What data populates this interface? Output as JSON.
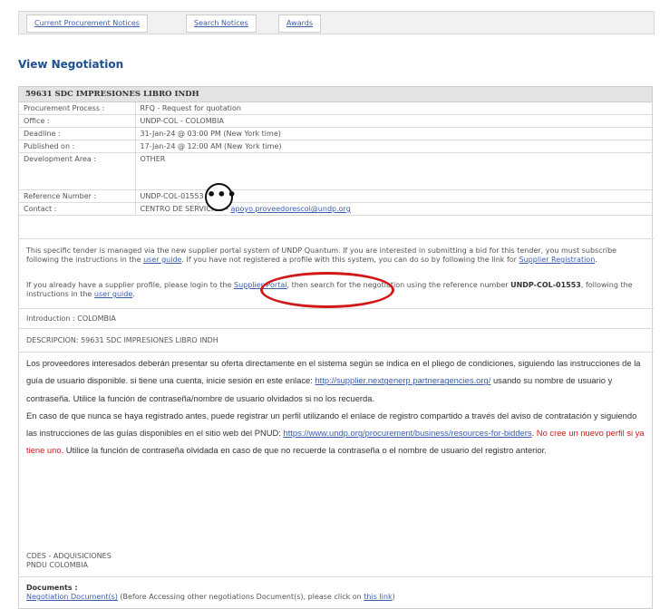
{
  "tabs": [
    {
      "label": "Current Procurement Notices"
    },
    {
      "label": "Search Notices"
    },
    {
      "label": "Awards"
    }
  ],
  "page_title": "View Negotiation",
  "negotiation": {
    "header": "59631 SDC IMPRESIONES LIBRO INDH",
    "rows": [
      {
        "label": "Procurement Process :",
        "value": "RFQ - Request for quotation"
      },
      {
        "label": "Office :",
        "value": "UNDP-COL - COLOMBIA"
      },
      {
        "label": "Deadline :",
        "value": "31-Jan-24 @ 03:00 PM (New York time)"
      },
      {
        "label": "Published on :",
        "value": "17-Jan-24 @ 12:00 AM (New York time)"
      },
      {
        "label": "Development Area :",
        "value": "OTHER"
      },
      {
        "label": "Reference Number :",
        "value": "UNDP-COL-01553"
      },
      {
        "label": "Contact :",
        "value": "CENTRO DE SERVICIOS - ",
        "link": "apoyo.proveedorescol@undp.org"
      }
    ]
  },
  "overflow_icon": "•••",
  "notice1": {
    "t1": "This specific tender is managed via the new supplier portal system of UNDP Quantum. If you are interested in submitting a bid for this tender, you must subscribe following the instructions in the ",
    "link1": "user guide",
    "t2": ". If you have not registered a profile with this system, you can do so by following the link for ",
    "link2": "Supplier Registration",
    "t3": "."
  },
  "notice2": {
    "t1": "If you already have a supplier profile, please login to the ",
    "link1": "Supplier Portal",
    "t2": ", then search for the negotiation using the reference number ",
    "ref": "UNDP-COL-01553",
    "t3": ", following the instructions in the ",
    "link2": "user guide",
    "t4": "."
  },
  "introduction": "Introduction : COLOMBIA",
  "descripcion": "DESCRIPCION: 59631 SDC IMPRESIONES LIBRO INDH",
  "desc": {
    "p1_a": "Los proveedores interesados deberán presentar su oferta directamente en el sistema según se indica en el pliego de condiciones, siguiendo las instrucciones de la guía de usuario disponible. si tiene una cuenta, inicie sesión en este enlace: ",
    "p1_link": "http://supplier.nextgenerp.partneragencies.org/",
    "p1_b": " usando su nombre de usuario y contraseña. Utilice la función de contraseña/nombre de usuario olvidados si no los recuerda.",
    "p2_a": "En caso de que nunca se haya registrado antes, puede registrar un perfil utilizando el enlace de registro compartido a través del aviso de contratación y siguiendo las instrucciones de las guías disponibles en el sitio web del PNUD: ",
    "p2_link": "https://www.undp.org/procurement/business/resources-for-bidders",
    "p2_b": ". ",
    "p2_red": "No cree un nuevo perfil si ya tiene uno.",
    "p2_c": " Utilice la función de contraseña olvidada en caso de que no recuerde la contraseña o el nombre de usuario del registro anterior."
  },
  "signature": {
    "line1": "CDES - ADQUISICIONES",
    "line2": "PNDU COLOMBIA"
  },
  "documents": {
    "heading": "Documents :",
    "link": "Negotiation Document(s)",
    "text": " (Before Accessing other negotiations Document(s), please click on ",
    "link2": "this link",
    "end": ")"
  },
  "colors": {
    "link": "#3a5dae",
    "title": "#1f4f8f",
    "highlight_oval": "#d21818",
    "header_bg": "#e3e3e3"
  }
}
